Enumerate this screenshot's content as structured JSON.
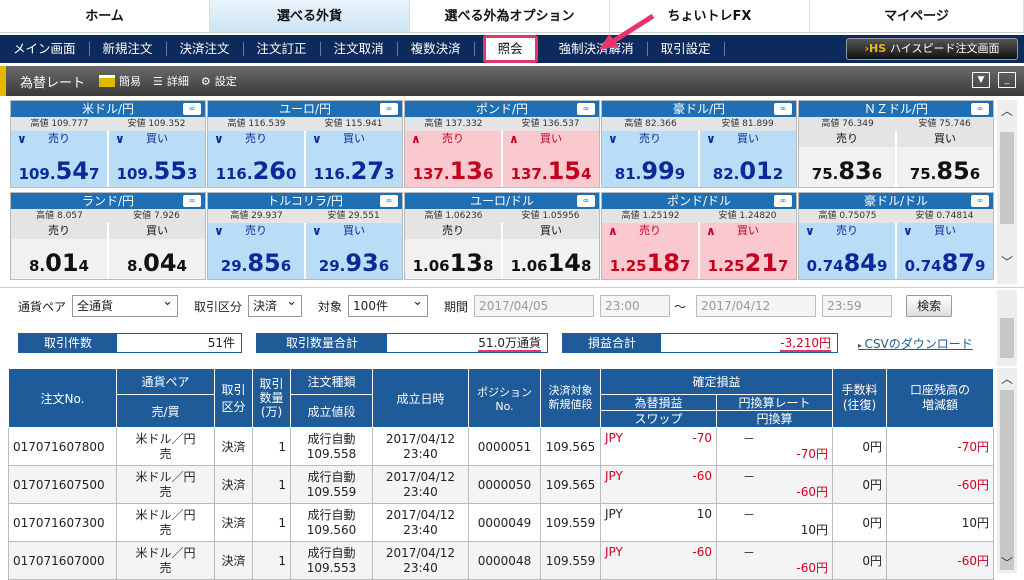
{
  "top_nav": [
    {
      "label": "ホーム",
      "w": 210,
      "active": false
    },
    {
      "label": "選べる外貨",
      "w": 200,
      "active": true
    },
    {
      "label": "選べる外為オプション",
      "w": 200,
      "active": false
    },
    {
      "label": "ちょいトレFX",
      "w": 200,
      "active": false
    },
    {
      "label": "マイページ",
      "w": 214,
      "active": false
    }
  ],
  "sub_nav": [
    "メイン画面",
    "新規注文",
    "決済注文",
    "注文訂正",
    "注文取消",
    "複数決済",
    "照会",
    "強制決済解消",
    "取引設定"
  ],
  "sub_nav_active": "照会",
  "hs_button": "ハイスピード注文画面",
  "rate_bar": {
    "title": "為替レート",
    "simple": "簡易",
    "detail": "詳細",
    "settings": "設定"
  },
  "panels": [
    {
      "name": "米ドル/円",
      "high": "高値 109.777",
      "low": "安値 109.352",
      "trend": "down",
      "sell": [
        "109.",
        "54",
        "7"
      ],
      "buy": [
        "109.",
        "55",
        "3"
      ]
    },
    {
      "name": "ユーロ/円",
      "high": "高値 116.539",
      "low": "安値 115.941",
      "trend": "down",
      "sell": [
        "116.",
        "26",
        "0"
      ],
      "buy": [
        "116.",
        "27",
        "3"
      ]
    },
    {
      "name": "ポンド/円",
      "high": "高値 137.332",
      "low": "安値 136.537",
      "trend": "up",
      "sell": [
        "137.",
        "13",
        "6"
      ],
      "buy": [
        "137.",
        "15",
        "4"
      ]
    },
    {
      "name": "豪ドル/円",
      "high": "高値 82.366",
      "low": "安値 81.899",
      "trend": "down",
      "sell": [
        "81.",
        "99",
        "9"
      ],
      "buy": [
        "82.",
        "01",
        "2"
      ]
    },
    {
      "name": "ＮＺドル/円",
      "high": "高値 76.349",
      "low": "安値 75.746",
      "trend": "neu",
      "sell": [
        "75.",
        "83",
        "6"
      ],
      "buy": [
        "75.",
        "85",
        "6"
      ]
    },
    {
      "name": "ランド/円",
      "high": "高値 8.057",
      "low": "安値 7.926",
      "trend": "neu",
      "sell": [
        "8.",
        "01",
        "4"
      ],
      "buy": [
        "8.",
        "04",
        "4"
      ]
    },
    {
      "name": "トルコリラ/円",
      "high": "高値 29.937",
      "low": "安値 29.551",
      "trend": "down",
      "sell": [
        "29.",
        "85",
        "6"
      ],
      "buy": [
        "29.",
        "93",
        "6"
      ]
    },
    {
      "name": "ユーロ/ドル",
      "high": "高値 1.06236",
      "low": "安値 1.05956",
      "trend": "neu",
      "sell": [
        "1.06",
        "13",
        "8"
      ],
      "buy": [
        "1.06",
        "14",
        "8"
      ]
    },
    {
      "name": "ポンド/ドル",
      "high": "高値 1.25192",
      "low": "安値 1.24820",
      "trend": "up",
      "sell": [
        "1.25",
        "18",
        "7"
      ],
      "buy": [
        "1.25",
        "21",
        "7"
      ]
    },
    {
      "name": "豪ドル/ドル",
      "high": "高値 0.75075",
      "low": "安値 0.74814",
      "trend": "down",
      "sell": [
        "0.74",
        "84",
        "9"
      ],
      "buy": [
        "0.74",
        "87",
        "9"
      ]
    }
  ],
  "labels": {
    "sell": "売り",
    "buy": "買い"
  },
  "filter": {
    "pair_label": "通貨ペア",
    "pair_value": "全通貨",
    "type_label": "取引区分",
    "type_value": "決済",
    "target_label": "対象",
    "target_value": "100件",
    "period_label": "期間",
    "date_from": "2017/04/05",
    "time_from": "23:00",
    "tilde": "～",
    "date_to": "2017/04/12",
    "time_to": "23:59",
    "search": "検索"
  },
  "summary": {
    "count_label": "取引件数",
    "count_value": "51件",
    "qty_label": "取引数量合計",
    "qty_value": "51.0万通貨",
    "pl_label": "損益合計",
    "pl_value": "-3,210円",
    "csv": "CSVのダウンロード"
  },
  "table": {
    "h_order": "注文No.",
    "h_pair": "通貨ペア",
    "h_side": "売/買",
    "h_kubun": "取引\n区分",
    "h_qty": "取引\n数量\n(万)",
    "h_otype": "注文種類",
    "h_oprice": "成立値段",
    "h_date": "成立日時",
    "h_pos": "ポジションNo.",
    "h_settle": "決済対象\n新規値段",
    "h_kakutei": "確定損益",
    "h_kawase": "為替損益",
    "h_rate": "円換算レート",
    "h_swap": "スワップ",
    "h_yen": "円換算",
    "h_fee": "手数料\n(往復)",
    "h_bal": "口座残高の\n増減額",
    "rows": [
      {
        "no": "017071607800",
        "pair": "米ドル／円",
        "side": "売",
        "kubun": "決済",
        "qty": "1",
        "otype": "成行自動",
        "oprice": "109.558",
        "date": "2017/04/12",
        "time": "23:40",
        "pos": "0000051",
        "settle": "109.565",
        "cur": "JPY",
        "fx": "-70",
        "rate": "－",
        "yen": "-70円",
        "fee": "0円",
        "bal": "-70円"
      },
      {
        "no": "017071607500",
        "pair": "米ドル／円",
        "side": "売",
        "kubun": "決済",
        "qty": "1",
        "otype": "成行自動",
        "oprice": "109.559",
        "date": "2017/04/12",
        "time": "23:40",
        "pos": "0000050",
        "settle": "109.565",
        "cur": "JPY",
        "fx": "-60",
        "rate": "－",
        "yen": "-60円",
        "fee": "0円",
        "bal": "-60円"
      },
      {
        "no": "017071607300",
        "pair": "米ドル／円",
        "side": "売",
        "kubun": "決済",
        "qty": "1",
        "otype": "成行自動",
        "oprice": "109.560",
        "date": "2017/04/12",
        "time": "23:40",
        "pos": "0000049",
        "settle": "109.559",
        "cur": "JPY",
        "fx": "10",
        "rate": "－",
        "yen": "10円",
        "fee": "0円",
        "bal": "10円"
      },
      {
        "no": "017071607000",
        "pair": "米ドル／円",
        "side": "売",
        "kubun": "決済",
        "qty": "1",
        "otype": "成行自動",
        "oprice": "109.553",
        "date": "2017/04/12",
        "time": "23:40",
        "pos": "0000048",
        "settle": "109.559",
        "cur": "JPY",
        "fx": "-60",
        "rate": "－",
        "yen": "-60円",
        "fee": "0円",
        "bal": "-60円"
      }
    ]
  },
  "colors": {
    "nav": "#0d2a5c",
    "accent": "#e8336b",
    "panel_head": "#1f6fb5",
    "table_head": "#1f5a99"
  }
}
